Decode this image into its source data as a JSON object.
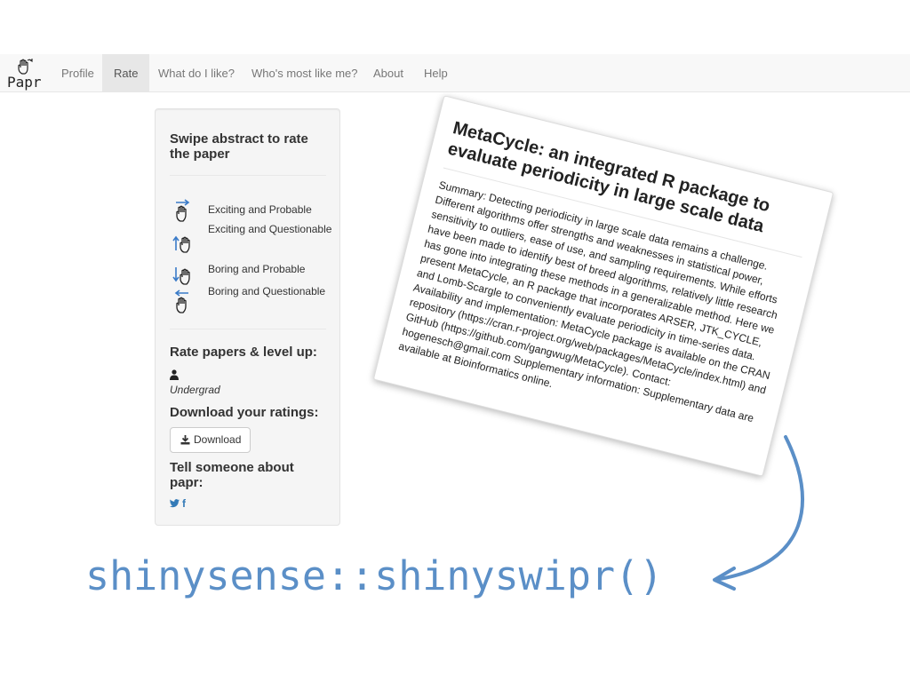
{
  "app": {
    "brand": "Papr",
    "brand_icon": "hand-swipe-icon"
  },
  "navbar": {
    "items": [
      {
        "label": "Profile",
        "active": false
      },
      {
        "label": "Rate",
        "active": true
      },
      {
        "label": "What do I like?",
        "active": false
      },
      {
        "label": "Who's most like me?",
        "active": false
      },
      {
        "label": "About",
        "active": false
      },
      {
        "label": "Help",
        "active": false
      }
    ]
  },
  "sidebar": {
    "swipe_heading": "Swipe abstract to rate the paper",
    "legend": [
      {
        "label": "Exciting and Probable",
        "icon": "swipe-right-icon"
      },
      {
        "label": "Exciting and Questionable",
        "icon": "swipe-up-icon"
      },
      {
        "label": "Boring and Probable",
        "icon": "swipe-down-icon"
      },
      {
        "label": "Boring and Questionable",
        "icon": "swipe-left-icon"
      }
    ],
    "rate_heading": "Rate papers & level up:",
    "user_icon": "user-icon",
    "level": "Undergrad",
    "download_heading": "Download your ratings:",
    "download_button": "Download",
    "download_icon": "download-icon",
    "tell_heading": "Tell someone about papr:",
    "social": {
      "twitter_icon": "twitter-icon",
      "facebook_label": "f"
    }
  },
  "card": {
    "title": "MetaCycle: an integrated R package to evaluate periodicity in large scale data",
    "abstract": "Summary: Detecting periodicity in large scale data remains a challenge. Different algorithms offer strengths and weaknesses in statistical power, sensitivity to outliers, ease of use, and sampling requirements. While efforts have been made to identify best of breed algorithms, relatively little research has gone into integrating these methods in a generalizable method. Here we present MetaCycle, an R package that incorporates ARSER, JTK_CYCLE, and Lomb-Scargle to conveniently evaluate periodicity in time-series data. Availability and implementation: MetaCycle package is available on the CRAN repository (https://cran.r-project.org/web/packages/MetaCycle/index.html) and GitHub (https://github.com/gangwug/MetaCycle). Contact: hogenesch@gmail.com Supplementary information: Supplementary data are available at Bioinformatics online."
  },
  "caption": {
    "text": "shinysense::shinyswipr()",
    "color": "#5b8fc7"
  }
}
